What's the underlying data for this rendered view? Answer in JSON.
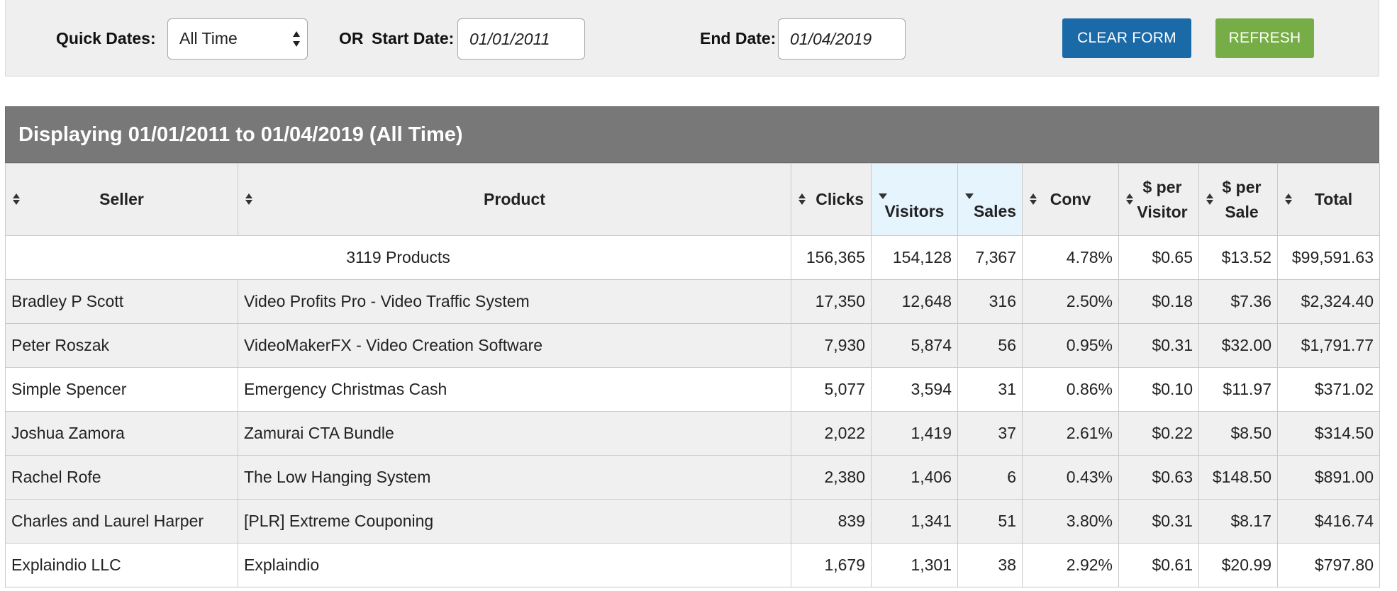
{
  "filters": {
    "quick_dates_label": "Quick Dates:",
    "quick_dates_value": "All Time",
    "or_label": "OR",
    "start_label": "Start Date:",
    "start_value": "01/01/2011",
    "end_label": "End Date:",
    "end_value": "01/04/2019",
    "clear_label": "CLEAR FORM",
    "refresh_label": "REFRESH"
  },
  "caption": "Displaying 01/01/2011 to 01/04/2019 (All Time)",
  "columns": {
    "seller": "Seller",
    "product": "Product",
    "clicks": "Clicks",
    "visitors": "Visitors",
    "sales": "Sales",
    "conv": "Conv",
    "per_visitor_1": "$ per",
    "per_visitor_2": "Visitor",
    "per_sale_1": "$ per",
    "per_sale_2": "Sale",
    "total": "Total"
  },
  "summary": {
    "products": "3119 Products",
    "clicks": "156,365",
    "visitors": "154,128",
    "sales": "7,367",
    "conv": "4.78%",
    "per_visitor": "$0.65",
    "per_sale": "$13.52",
    "total": "$99,591.63"
  },
  "rows": [
    {
      "seller": "Bradley P Scott",
      "product": "Video Profits Pro - Video Traffic System",
      "clicks": "17,350",
      "visitors": "12,648",
      "sales": "316",
      "conv": "2.50%",
      "per_visitor": "$0.18",
      "per_sale": "$7.36",
      "total": "$2,324.40"
    },
    {
      "seller": "Peter Roszak",
      "product": "VideoMakerFX - Video Creation Software",
      "clicks": "7,930",
      "visitors": "5,874",
      "sales": "56",
      "conv": "0.95%",
      "per_visitor": "$0.31",
      "per_sale": "$32.00",
      "total": "$1,791.77"
    },
    {
      "seller": "Simple Spencer",
      "product": "Emergency Christmas Cash",
      "clicks": "5,077",
      "visitors": "3,594",
      "sales": "31",
      "conv": "0.86%",
      "per_visitor": "$0.10",
      "per_sale": "$11.97",
      "total": "$371.02"
    },
    {
      "seller": "Joshua Zamora",
      "product": "Zamurai CTA Bundle",
      "clicks": "2,022",
      "visitors": "1,419",
      "sales": "37",
      "conv": "2.61%",
      "per_visitor": "$0.22",
      "per_sale": "$8.50",
      "total": "$314.50"
    },
    {
      "seller": "Rachel Rofe",
      "product": "The Low Hanging System",
      "clicks": "2,380",
      "visitors": "1,406",
      "sales": "6",
      "conv": "0.43%",
      "per_visitor": "$0.63",
      "per_sale": "$148.50",
      "total": "$891.00"
    },
    {
      "seller": "Charles and Laurel Harper",
      "product": "[PLR] Extreme Couponing",
      "clicks": "839",
      "visitors": "1,341",
      "sales": "51",
      "conv": "3.80%",
      "per_visitor": "$0.31",
      "per_sale": "$8.17",
      "total": "$416.74"
    },
    {
      "seller": "Explaindio LLC",
      "product": "Explaindio",
      "clicks": "1,679",
      "visitors": "1,301",
      "sales": "38",
      "conv": "2.92%",
      "per_visitor": "$0.61",
      "per_sale": "$20.99",
      "total": "$797.80"
    }
  ],
  "icons": {
    "sort": "sort-both-icon",
    "sort_desc": "sort-desc-icon",
    "select_arrows": "select-arrows-icon"
  },
  "colors": {
    "clear_button": "#1b6aa8",
    "refresh_button": "#76ad46",
    "caption_bg": "#787878",
    "active_header": "#e6f4fd"
  }
}
